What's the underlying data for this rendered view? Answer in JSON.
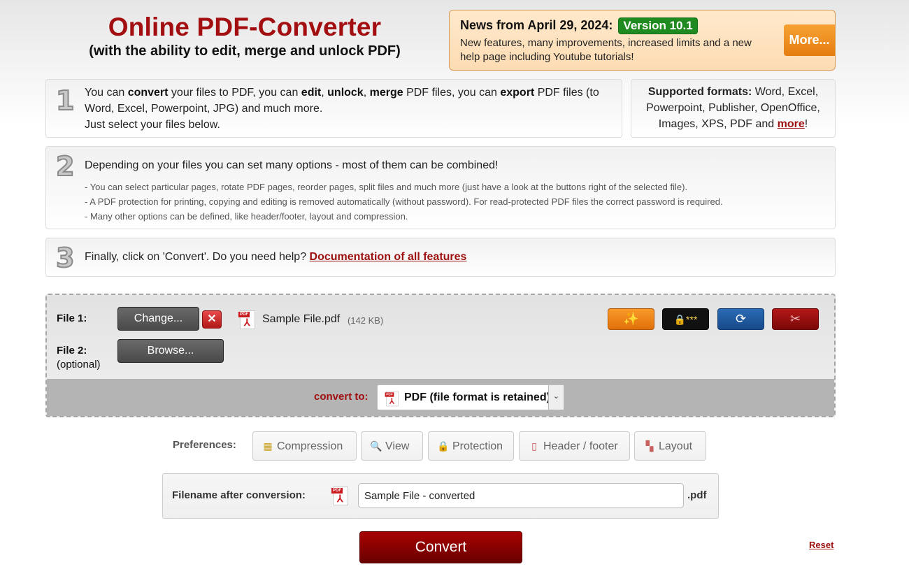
{
  "header": {
    "title": "Online PDF-Converter",
    "subtitle": "(with the ability to edit, merge and unlock PDF)"
  },
  "news": {
    "heading": "News from April 29, 2024:",
    "badge": "Version 10.1",
    "text": "New features, many improvements, increased limits and a new help page including Youtube tutorials!",
    "more_label": "More..."
  },
  "steps": {
    "step1": {
      "number": "1",
      "segments": [
        {
          "t": "You can ",
          "b": false
        },
        {
          "t": "convert",
          "b": true
        },
        {
          "t": " your files to PDF, you can ",
          "b": false
        },
        {
          "t": "edit",
          "b": true
        },
        {
          "t": ", ",
          "b": false
        },
        {
          "t": "unlock",
          "b": true
        },
        {
          "t": ", ",
          "b": false
        },
        {
          "t": "merge",
          "b": true
        },
        {
          "t": " PDF files, you can ",
          "b": false
        },
        {
          "t": "export",
          "b": true
        },
        {
          "t": " PDF files (to Word, Excel, Powerpoint, JPG) and much more.",
          "b": false
        }
      ],
      "line2": "Just select your files below."
    },
    "formats": {
      "label": "Supported formats:",
      "text": " Word, Excel, Powerpoint, Publisher, OpenOffice, Images, XPS, PDF and ",
      "more_link": "more",
      "suffix": "!"
    },
    "step2": {
      "number": "2",
      "heading": "Depending on your files you can set many options - most of them can be combined!",
      "bullets": [
        "- You can select particular pages, rotate PDF pages, reorder pages, split files and much more (just have a look at the buttons right of the selected file).",
        "- A PDF protection for printing, copying and editing is removed automatically (without password). For read-protected PDF files the correct password is required.",
        "- Many other options can be defined, like header/footer, layout and compression."
      ]
    },
    "step3": {
      "number": "3",
      "text": "Finally, click on 'Convert'. Do you need help? ",
      "link": "Documentation of all features"
    }
  },
  "upload": {
    "file1_label": "File 1:",
    "file1_button": "Change...",
    "file1_name": "Sample File.pdf",
    "file1_size": "(142 KB)",
    "file2_label": "File 2:",
    "file2_sub": "(optional)",
    "file2_button": "Browse...",
    "tools": [
      {
        "name": "edit-tool",
        "icon": "magic-wand-icon",
        "glyph": "✨"
      },
      {
        "name": "protect-tool",
        "icon": "padlock-password-icon",
        "glyph": "🔒***"
      },
      {
        "name": "rotate-tool",
        "icon": "rotate-page-icon",
        "glyph": "⟳"
      },
      {
        "name": "split-tool",
        "icon": "scissors-icon",
        "glyph": "✂"
      }
    ],
    "convert_to_label": "convert to:",
    "convert_to_value": "PDF (file format is retained)"
  },
  "preferences": {
    "label": "Preferences:",
    "buttons": [
      {
        "label": "Compression",
        "glyph": "▦"
      },
      {
        "label": "View",
        "glyph": "🔍"
      },
      {
        "label": "Protection",
        "glyph": "🔒"
      },
      {
        "label": "Header / footer",
        "glyph": "▯"
      },
      {
        "label": "Layout",
        "glyph": "▚"
      }
    ]
  },
  "filename": {
    "label": "Filename after conversion:",
    "value": "Sample File - converted",
    "extension": ".pdf"
  },
  "actions": {
    "convert_label": "Convert",
    "reset_label": "Reset"
  }
}
